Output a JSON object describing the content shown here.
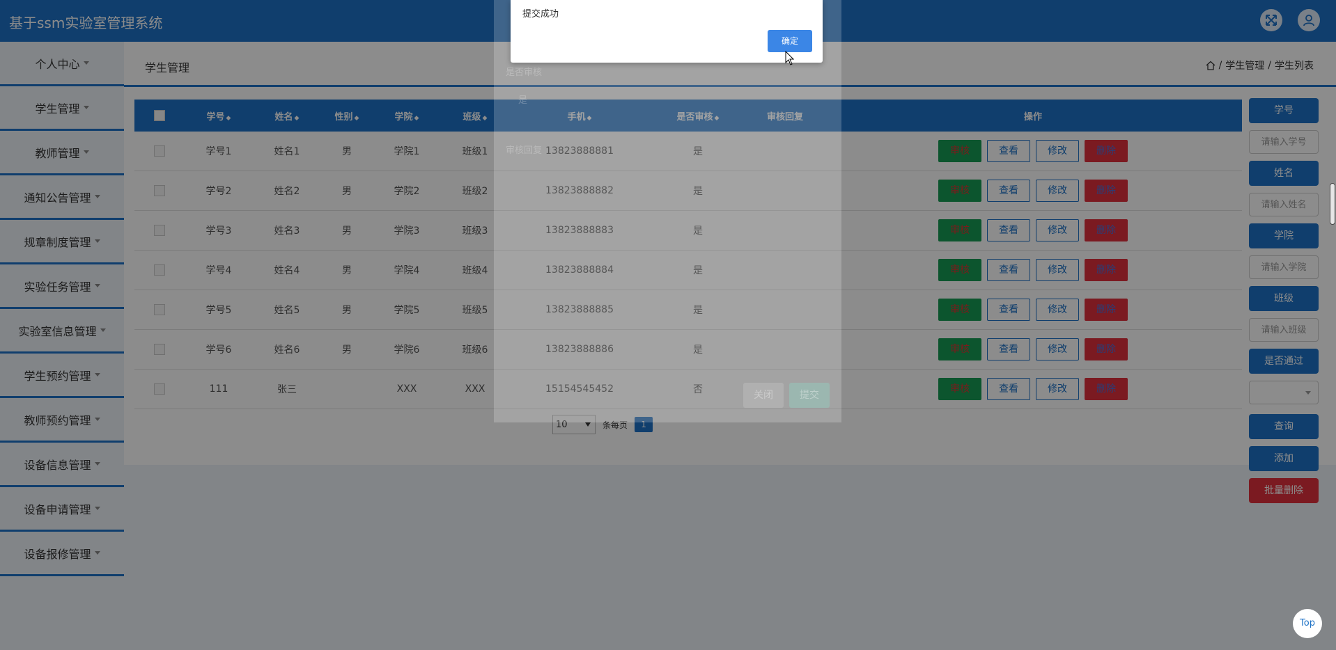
{
  "app": {
    "title": "基于ssm实验室管理系统"
  },
  "sidebar": {
    "items": [
      {
        "label": "个人中心"
      },
      {
        "label": "学生管理"
      },
      {
        "label": "教师管理"
      },
      {
        "label": "通知公告管理"
      },
      {
        "label": "规章制度管理"
      },
      {
        "label": "实验任务管理"
      },
      {
        "label": "实验室信息管理"
      },
      {
        "label": "学生预约管理"
      },
      {
        "label": "教师预约管理"
      },
      {
        "label": "设备信息管理"
      },
      {
        "label": "设备申请管理"
      },
      {
        "label": "设备报修管理"
      }
    ]
  },
  "header": {
    "title": "学生管理",
    "breadcrumb": [
      "学生管理",
      "学生列表"
    ],
    "separator": "/"
  },
  "table": {
    "columns": [
      "学号",
      "姓名",
      "性别",
      "学院",
      "班级",
      "手机",
      "是否审核",
      "审核回复",
      "操作"
    ],
    "rows": [
      {
        "xuehao": "学号1",
        "xingming": "姓名1",
        "xingbie": "男",
        "xueyuan": "学院1",
        "banji": "班级1",
        "shouji": "13823888881",
        "shenhe": "是",
        "huifu": ""
      },
      {
        "xuehao": "学号2",
        "xingming": "姓名2",
        "xingbie": "男",
        "xueyuan": "学院2",
        "banji": "班级2",
        "shouji": "13823888882",
        "shenhe": "是",
        "huifu": ""
      },
      {
        "xuehao": "学号3",
        "xingming": "姓名3",
        "xingbie": "男",
        "xueyuan": "学院3",
        "banji": "班级3",
        "shouji": "13823888883",
        "shenhe": "是",
        "huifu": ""
      },
      {
        "xuehao": "学号4",
        "xingming": "姓名4",
        "xingbie": "男",
        "xueyuan": "学院4",
        "banji": "班级4",
        "shouji": "13823888884",
        "shenhe": "是",
        "huifu": ""
      },
      {
        "xuehao": "学号5",
        "xingming": "姓名5",
        "xingbie": "男",
        "xueyuan": "学院5",
        "banji": "班级5",
        "shouji": "13823888885",
        "shenhe": "是",
        "huifu": ""
      },
      {
        "xuehao": "学号6",
        "xingming": "姓名6",
        "xingbie": "男",
        "xueyuan": "学院6",
        "banji": "班级6",
        "shouji": "13823888886",
        "shenhe": "是",
        "huifu": ""
      },
      {
        "xuehao": "111",
        "xingming": "张三",
        "xingbie": "",
        "xueyuan": "XXX",
        "banji": "XXX",
        "shouji": "15154545452",
        "shenhe": "否",
        "huifu": ""
      }
    ],
    "actions": {
      "audit": "审核",
      "view": "查看",
      "edit": "修改",
      "delete": "删除"
    }
  },
  "pager": {
    "page_size": "10",
    "per_page_label": "条每页",
    "current_page": "1"
  },
  "search": {
    "xuehao_label": "学号",
    "xuehao_placeholder": "请输入学号",
    "xingming_label": "姓名",
    "xingming_placeholder": "请输入姓名",
    "xueyuan_label": "学院",
    "xueyuan_placeholder": "请输入学院",
    "banji_label": "班级",
    "banji_placeholder": "请输入班级",
    "tongguo_label": "是否通过",
    "tongguo_value": "",
    "query_label": "查询",
    "add_label": "添加",
    "batch_delete_label": "批量删除"
  },
  "bg_dialog": {
    "field1_label": "是否审核",
    "field1_value": "是",
    "field2_label": "审核回复",
    "close_label": "关闭",
    "submit_label": "提交"
  },
  "alert": {
    "message": "提交成功",
    "ok_label": "确定"
  },
  "top_button": {
    "label": "Top"
  },
  "colors": {
    "primary": "#1e72c6",
    "audit": "#179b55",
    "danger": "#e0313d",
    "confirm": "#3b86e6"
  }
}
